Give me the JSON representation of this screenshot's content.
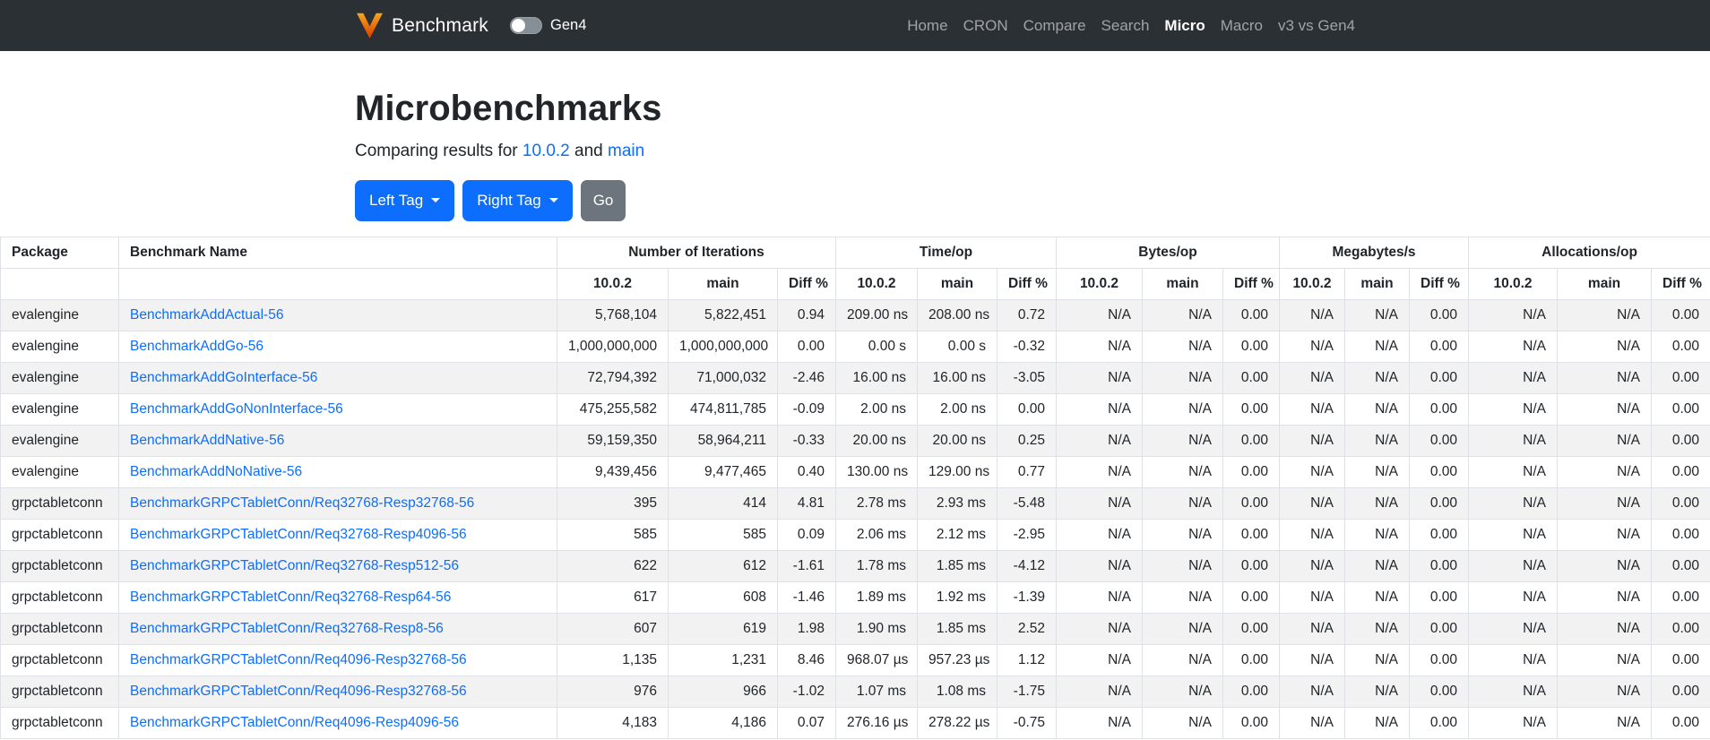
{
  "navbar": {
    "brand": "Benchmark",
    "toggle_label": "Gen4",
    "links": [
      {
        "label": "Home",
        "active": false
      },
      {
        "label": "CRON",
        "active": false
      },
      {
        "label": "Compare",
        "active": false
      },
      {
        "label": "Search",
        "active": false
      },
      {
        "label": "Micro",
        "active": true
      },
      {
        "label": "Macro",
        "active": false
      },
      {
        "label": "v3 vs Gen4",
        "active": false
      }
    ]
  },
  "header": {
    "title": "Microbenchmarks",
    "subtitle_prefix": "Comparing results for",
    "left_tag": "10.0.2",
    "conjunction": "and",
    "right_tag": "main"
  },
  "toolbar": {
    "left_tag_label": "Left Tag",
    "right_tag_label": "Right Tag",
    "go_label": "Go"
  },
  "table": {
    "col_package": "Package",
    "col_benchmark": "Benchmark Name",
    "groups": [
      "Number of Iterations",
      "Time/op",
      "Bytes/op",
      "Megabytes/s",
      "Allocations/op"
    ],
    "sub_headers": [
      "10.0.2",
      "main",
      "Diff %"
    ],
    "rows": [
      {
        "package": "evalengine",
        "name": "BenchmarkAddActual-56",
        "iterations": [
          "5,768,104",
          "5,822,451",
          "0.94"
        ],
        "time": [
          "209.00 ns",
          "208.00 ns",
          "0.72"
        ],
        "bytes": [
          "N/A",
          "N/A",
          "0.00"
        ],
        "megabytes": [
          "N/A",
          "N/A",
          "0.00"
        ],
        "allocations": [
          "N/A",
          "N/A",
          "0.00"
        ]
      },
      {
        "package": "evalengine",
        "name": "BenchmarkAddGo-56",
        "iterations": [
          "1,000,000,000",
          "1,000,000,000",
          "0.00"
        ],
        "time": [
          "0.00 s",
          "0.00 s",
          "-0.32"
        ],
        "bytes": [
          "N/A",
          "N/A",
          "0.00"
        ],
        "megabytes": [
          "N/A",
          "N/A",
          "0.00"
        ],
        "allocations": [
          "N/A",
          "N/A",
          "0.00"
        ]
      },
      {
        "package": "evalengine",
        "name": "BenchmarkAddGoInterface-56",
        "iterations": [
          "72,794,392",
          "71,000,032",
          "-2.46"
        ],
        "time": [
          "16.00 ns",
          "16.00 ns",
          "-3.05"
        ],
        "bytes": [
          "N/A",
          "N/A",
          "0.00"
        ],
        "megabytes": [
          "N/A",
          "N/A",
          "0.00"
        ],
        "allocations": [
          "N/A",
          "N/A",
          "0.00"
        ]
      },
      {
        "package": "evalengine",
        "name": "BenchmarkAddGoNonInterface-56",
        "iterations": [
          "475,255,582",
          "474,811,785",
          "-0.09"
        ],
        "time": [
          "2.00 ns",
          "2.00 ns",
          "0.00"
        ],
        "bytes": [
          "N/A",
          "N/A",
          "0.00"
        ],
        "megabytes": [
          "N/A",
          "N/A",
          "0.00"
        ],
        "allocations": [
          "N/A",
          "N/A",
          "0.00"
        ]
      },
      {
        "package": "evalengine",
        "name": "BenchmarkAddNative-56",
        "iterations": [
          "59,159,350",
          "58,964,211",
          "-0.33"
        ],
        "time": [
          "20.00 ns",
          "20.00 ns",
          "0.25"
        ],
        "bytes": [
          "N/A",
          "N/A",
          "0.00"
        ],
        "megabytes": [
          "N/A",
          "N/A",
          "0.00"
        ],
        "allocations": [
          "N/A",
          "N/A",
          "0.00"
        ]
      },
      {
        "package": "evalengine",
        "name": "BenchmarkAddNoNative-56",
        "iterations": [
          "9,439,456",
          "9,477,465",
          "0.40"
        ],
        "time": [
          "130.00 ns",
          "129.00 ns",
          "0.77"
        ],
        "bytes": [
          "N/A",
          "N/A",
          "0.00"
        ],
        "megabytes": [
          "N/A",
          "N/A",
          "0.00"
        ],
        "allocations": [
          "N/A",
          "N/A",
          "0.00"
        ]
      },
      {
        "package": "grpctabletconn",
        "name": "BenchmarkGRPCTabletConn/Req32768-Resp32768-56",
        "iterations": [
          "395",
          "414",
          "4.81"
        ],
        "time": [
          "2.78 ms",
          "2.93 ms",
          "-5.48"
        ],
        "bytes": [
          "N/A",
          "N/A",
          "0.00"
        ],
        "megabytes": [
          "N/A",
          "N/A",
          "0.00"
        ],
        "allocations": [
          "N/A",
          "N/A",
          "0.00"
        ]
      },
      {
        "package": "grpctabletconn",
        "name": "BenchmarkGRPCTabletConn/Req32768-Resp4096-56",
        "iterations": [
          "585",
          "585",
          "0.09"
        ],
        "time": [
          "2.06 ms",
          "2.12 ms",
          "-2.95"
        ],
        "bytes": [
          "N/A",
          "N/A",
          "0.00"
        ],
        "megabytes": [
          "N/A",
          "N/A",
          "0.00"
        ],
        "allocations": [
          "N/A",
          "N/A",
          "0.00"
        ]
      },
      {
        "package": "grpctabletconn",
        "name": "BenchmarkGRPCTabletConn/Req32768-Resp512-56",
        "iterations": [
          "622",
          "612",
          "-1.61"
        ],
        "time": [
          "1.78 ms",
          "1.85 ms",
          "-4.12"
        ],
        "bytes": [
          "N/A",
          "N/A",
          "0.00"
        ],
        "megabytes": [
          "N/A",
          "N/A",
          "0.00"
        ],
        "allocations": [
          "N/A",
          "N/A",
          "0.00"
        ]
      },
      {
        "package": "grpctabletconn",
        "name": "BenchmarkGRPCTabletConn/Req32768-Resp64-56",
        "iterations": [
          "617",
          "608",
          "-1.46"
        ],
        "time": [
          "1.89 ms",
          "1.92 ms",
          "-1.39"
        ],
        "bytes": [
          "N/A",
          "N/A",
          "0.00"
        ],
        "megabytes": [
          "N/A",
          "N/A",
          "0.00"
        ],
        "allocations": [
          "N/A",
          "N/A",
          "0.00"
        ]
      },
      {
        "package": "grpctabletconn",
        "name": "BenchmarkGRPCTabletConn/Req32768-Resp8-56",
        "iterations": [
          "607",
          "619",
          "1.98"
        ],
        "time": [
          "1.90 ms",
          "1.85 ms",
          "2.52"
        ],
        "bytes": [
          "N/A",
          "N/A",
          "0.00"
        ],
        "megabytes": [
          "N/A",
          "N/A",
          "0.00"
        ],
        "allocations": [
          "N/A",
          "N/A",
          "0.00"
        ]
      },
      {
        "package": "grpctabletconn",
        "name": "BenchmarkGRPCTabletConn/Req4096-Resp32768-56",
        "iterations": [
          "1,135",
          "1,231",
          "8.46"
        ],
        "time": [
          "968.07 µs",
          "957.23 µs",
          "1.12"
        ],
        "bytes": [
          "N/A",
          "N/A",
          "0.00"
        ],
        "megabytes": [
          "N/A",
          "N/A",
          "0.00"
        ],
        "allocations": [
          "N/A",
          "N/A",
          "0.00"
        ]
      },
      {
        "package": "grpctabletconn",
        "name": "BenchmarkGRPCTabletConn/Req4096-Resp32768-56",
        "iterations": [
          "976",
          "966",
          "-1.02"
        ],
        "time": [
          "1.07 ms",
          "1.08 ms",
          "-1.75"
        ],
        "bytes": [
          "N/A",
          "N/A",
          "0.00"
        ],
        "megabytes": [
          "N/A",
          "N/A",
          "0.00"
        ],
        "allocations": [
          "N/A",
          "N/A",
          "0.00"
        ]
      },
      {
        "package": "grpctabletconn",
        "name": "BenchmarkGRPCTabletConn/Req4096-Resp4096-56",
        "iterations": [
          "4,183",
          "4,186",
          "0.07"
        ],
        "time": [
          "276.16 µs",
          "278.22 µs",
          "-0.75"
        ],
        "bytes": [
          "N/A",
          "N/A",
          "0.00"
        ],
        "megabytes": [
          "N/A",
          "N/A",
          "0.00"
        ],
        "allocations": [
          "N/A",
          "N/A",
          "0.00"
        ]
      }
    ]
  },
  "colors": {
    "navbar_bg": "#2b3035",
    "primary_blue": "#0d6efd",
    "secondary_gray": "#6c757d",
    "link_blue": "#0d6efd",
    "brand_orange": "#f28c28",
    "stripe_bg": "#f2f2f2",
    "table_border": "#dee2e6"
  }
}
